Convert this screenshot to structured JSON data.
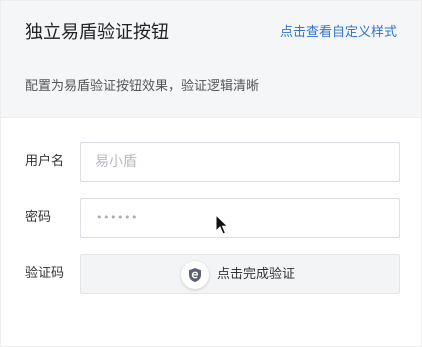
{
  "header": {
    "title": "独立易盾验证按钮",
    "link_label": "点击查看自定义样式",
    "description": "配置为易盾验证按钮效果，验证逻辑清晰"
  },
  "form": {
    "username": {
      "label": "用户名",
      "placeholder": "易小盾"
    },
    "password": {
      "label": "密码",
      "masked_value": "••••••"
    },
    "captcha": {
      "label": "验证码",
      "button_label": "点击完成验证",
      "icon": "shield-icon"
    }
  },
  "colors": {
    "link": "#2f74d0",
    "header_bg": "#f5f6f8",
    "captcha_bg": "#f3f4f6"
  }
}
